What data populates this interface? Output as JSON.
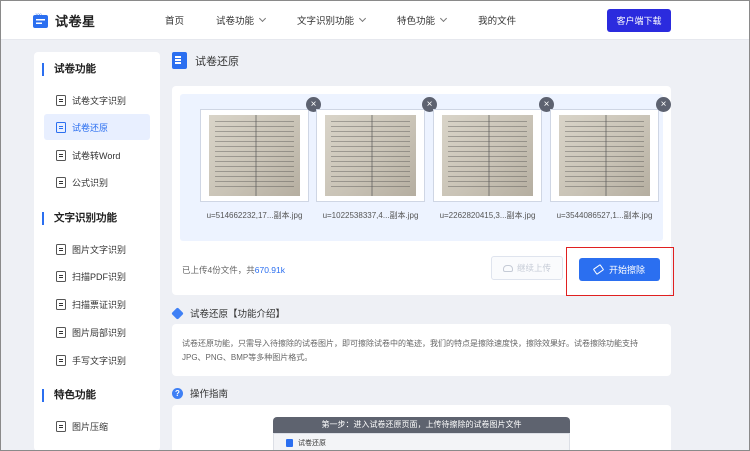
{
  "brand": {
    "name": "试卷星",
    "accent": "#2b6ff0",
    "cta_color": "#2b2bde"
  },
  "nav": {
    "items": [
      {
        "label": "首页",
        "has_dropdown": false
      },
      {
        "label": "试卷功能",
        "has_dropdown": true
      },
      {
        "label": "文字识别功能",
        "has_dropdown": true
      },
      {
        "label": "特色功能",
        "has_dropdown": true
      },
      {
        "label": "我的文件",
        "has_dropdown": false
      }
    ],
    "download_label": "客户端下载"
  },
  "sidebar": {
    "sections": [
      {
        "title": "试卷功能",
        "items": [
          {
            "label": "试卷文字识别",
            "active": false
          },
          {
            "label": "试卷还原",
            "active": true
          },
          {
            "label": "试卷转Word",
            "active": false
          },
          {
            "label": "公式识别",
            "active": false
          }
        ]
      },
      {
        "title": "文字识别功能",
        "items": [
          {
            "label": "图片文字识别",
            "active": false
          },
          {
            "label": "扫描PDF识别",
            "active": false
          },
          {
            "label": "扫描票证识别",
            "active": false
          },
          {
            "label": "图片局部识别",
            "active": false
          },
          {
            "label": "手写文字识别",
            "active": false
          }
        ]
      },
      {
        "title": "特色功能",
        "items": [
          {
            "label": "图片压缩",
            "active": false
          }
        ]
      }
    ]
  },
  "main": {
    "title": "试卷还原",
    "files": [
      {
        "name": "u=514662232,17...副本.jpg"
      },
      {
        "name": "u=1022538337,4...副本.jpg"
      },
      {
        "name": "u=2262820415,3...副本.jpg"
      },
      {
        "name": "u=3544086527,1...副本.jpg"
      }
    ],
    "upload_info_prefix": "已上传4份文件，共",
    "upload_info_size": "670.91k",
    "add_upload_label": "继续上传",
    "erase_label": "开始擦除",
    "close_symbol": "×"
  },
  "intro": {
    "title": "试卷还原【功能介绍】",
    "text": "试卷还原功能，只需导入待擦除的试卷图片，即可擦除试卷中的笔迹，我们的特点是擦除速度快，擦除效果好。试卷擦除功能支持JPG、PNG、BMP等多种图片格式。"
  },
  "guide": {
    "title": "操作指南",
    "step1_banner": "第一步：进入试卷还原页面，上传待擦除的试卷图片文件",
    "step1_inner_title": "试卷还原"
  }
}
